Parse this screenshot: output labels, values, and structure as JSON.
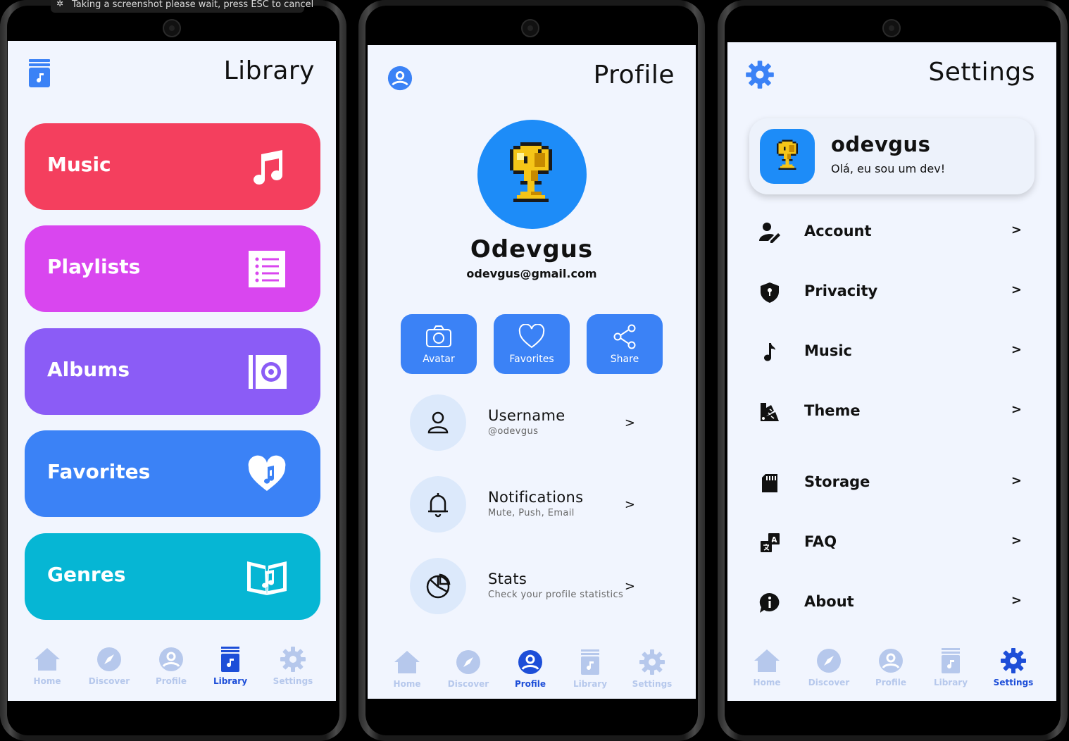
{
  "toast": {
    "text": "Taking a screenshot please wait, press ESC to cancel"
  },
  "nav_labels": {
    "home": "Home",
    "discover": "Discover",
    "profile": "Profile",
    "library": "Library",
    "settings": "Settings"
  },
  "library": {
    "title": "Library",
    "cards": [
      {
        "label": "Music",
        "color": "#f43f5e",
        "icon": "music-note-icon"
      },
      {
        "label": "Playlists",
        "color": "#d946ef",
        "icon": "list-icon"
      },
      {
        "label": "Albums",
        "color": "#8b5cf6",
        "icon": "album-icon"
      },
      {
        "label": "Favorites",
        "color": "#3b82f6",
        "icon": "heart-music-icon"
      },
      {
        "label": "Genres",
        "color": "#06b6d4",
        "icon": "book-music-icon"
      }
    ],
    "active_nav": "Library"
  },
  "profile": {
    "title": "Profile",
    "name": "Odevgus",
    "email": "odevgus@gmail.com",
    "actions": [
      {
        "label": "Avatar",
        "icon": "camera-icon"
      },
      {
        "label": "Favorites",
        "icon": "heart-icon"
      },
      {
        "label": "Share",
        "icon": "share-icon"
      }
    ],
    "rows": [
      {
        "title": "Username",
        "subtitle": "@odevgus",
        "icon": "user-icon"
      },
      {
        "title": "Notifications",
        "subtitle": "Mute, Push, Email",
        "icon": "bell-icon"
      },
      {
        "title": "Stats",
        "subtitle": "Check your profile statistics",
        "icon": "pie-chart-icon"
      }
    ],
    "chevron": ">",
    "active_nav": "Profile"
  },
  "settings": {
    "title": "Settings",
    "user": {
      "name": "odevgus",
      "bio": "Olá, eu sou um dev!"
    },
    "items": [
      {
        "label": "Account",
        "icon": "user-edit-icon"
      },
      {
        "label": "Privacity",
        "icon": "shield-icon"
      },
      {
        "label": "Music",
        "icon": "music-note-icon"
      },
      {
        "label": "Theme",
        "icon": "palette-icon"
      },
      {
        "label": "Storage",
        "icon": "sd-card-icon"
      },
      {
        "label": "FAQ",
        "icon": "translate-icon"
      },
      {
        "label": "About",
        "icon": "info-icon"
      }
    ],
    "chevron": ">",
    "active_nav": "Settings"
  },
  "colors": {
    "accent": "#3b82f6",
    "nav_inactive": "#b6c8ec",
    "nav_active": "#1d4ed8",
    "screen_bg": "#f1f5fe"
  }
}
